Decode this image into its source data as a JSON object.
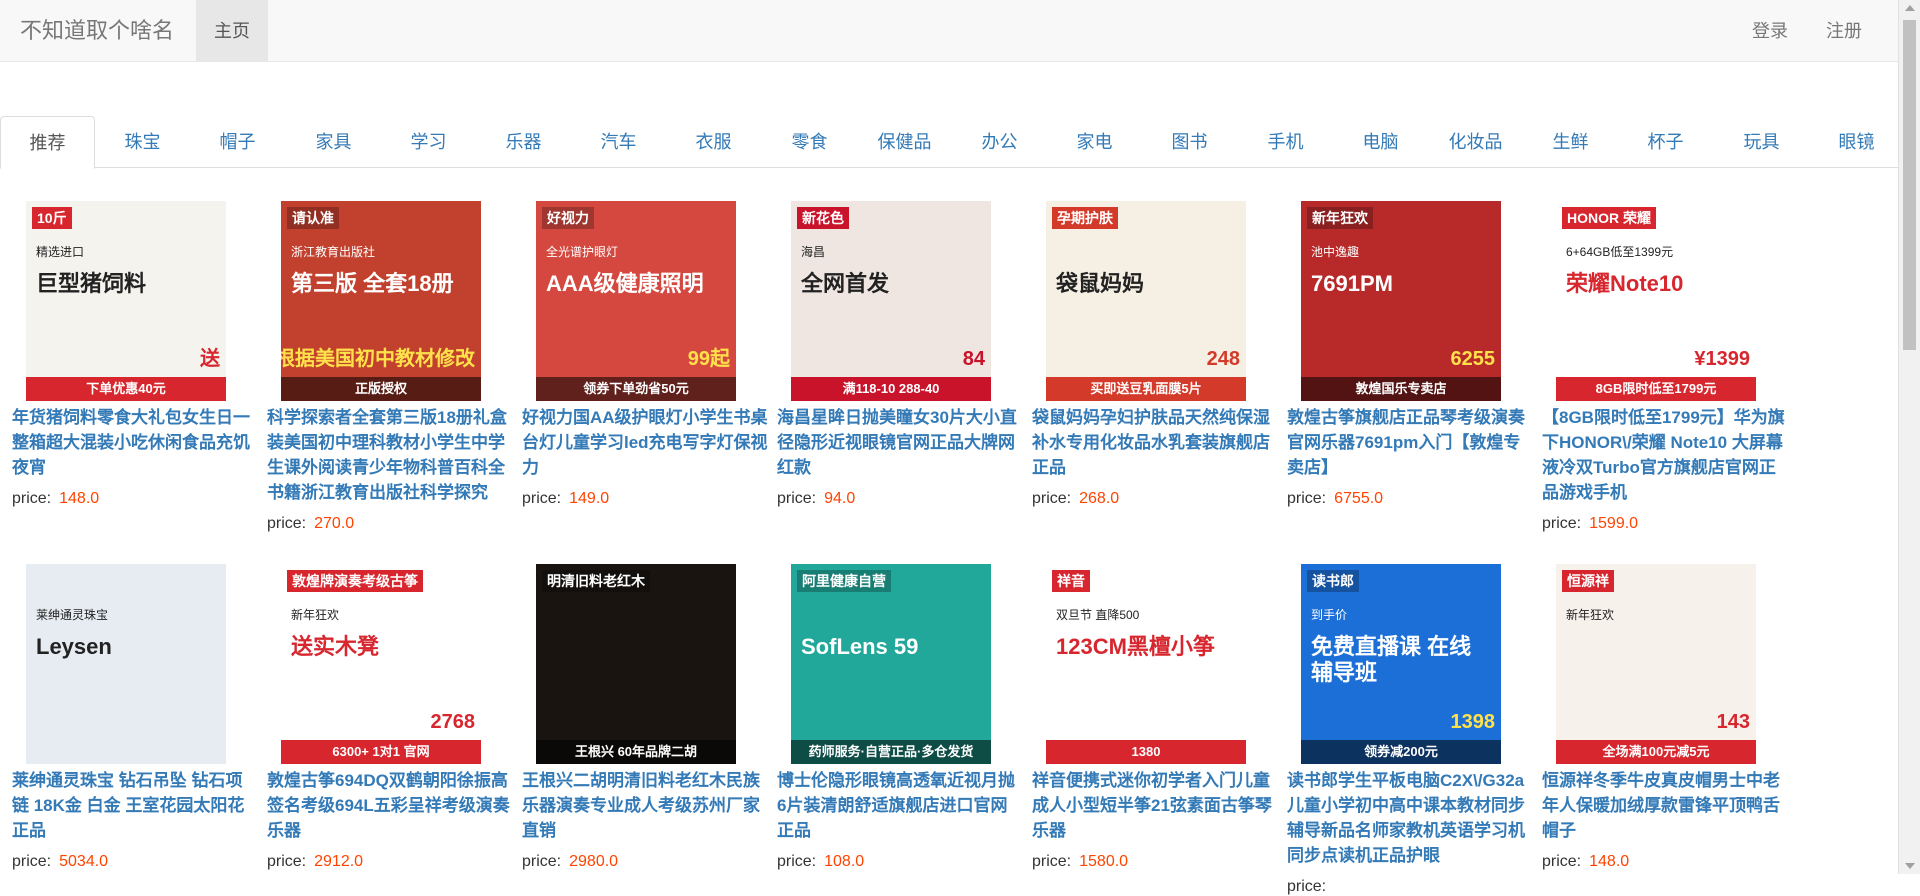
{
  "navbar": {
    "brand": "不知道取个啥名",
    "home": "主页",
    "login": "登录",
    "register": "注册"
  },
  "tabs": [
    "推荐",
    "珠宝",
    "帽子",
    "家具",
    "学习",
    "乐器",
    "汽车",
    "衣服",
    "零食",
    "保健品",
    "办公",
    "家电",
    "图书",
    "手机",
    "电脑",
    "化妆品",
    "生鲜",
    "杯子",
    "玩具",
    "眼镜"
  ],
  "price_label": "price:",
  "products": [
    {
      "title": "年货猪饲料零食大礼包女生日一整箱超大混装小吃休闲食品充饥夜宵",
      "price": "148.0",
      "img": {
        "bg": "#f5f3ee",
        "accent": "#d8262e",
        "badge": "10斤",
        "big": "巨型猪饲料",
        "band": "下单优惠40元",
        "sub": "精选进口",
        "corner": "送"
      }
    },
    {
      "title": "科学探索者全套第三版18册礼盒装美国初中理科教材小学生中学生课外阅读青少年物科普百科全书籍浙江教育出版社科学探究",
      "price": "270.0",
      "img": {
        "bg": "#c2412e",
        "accent": "#1f6e35",
        "badge": "请认准",
        "big": "第三版 全套18册",
        "band": "正版授权",
        "sub": "浙江教育出版社",
        "corner": "根据美国初中教材修改"
      }
    },
    {
      "title": "好视力国AA级护眼灯小学生书桌台灯儿童学习led充电写字灯保视力",
      "price": "149.0",
      "img": {
        "bg": "#d5483f",
        "accent": "#ffffff",
        "badge": "好视力",
        "big": "AAA级健康照明",
        "band": "领券下单劲省50元",
        "sub": "全光谱护眼灯",
        "corner": "99起"
      }
    },
    {
      "title": "海昌星眸日抛美瞳女30片大小直径隐形近视眼镜官网正品大牌网红款",
      "price": "94.0",
      "img": {
        "bg": "#efe6e1",
        "accent": "#c8132b",
        "badge": "新花色",
        "big": "全网首发",
        "band": "满118-10 288-40",
        "sub": "海昌",
        "corner": "84"
      }
    },
    {
      "title": "袋鼠妈妈孕妇护肤品天然纯保湿补水专用化妆品水乳套装旗舰店正品",
      "price": "268.0",
      "img": {
        "bg": "#f6efe4",
        "accent": "#d43a2a",
        "badge": "孕期护肤",
        "big": "袋鼠妈妈",
        "band": "买即送豆乳面膜5片",
        "sub": "",
        "corner": "248"
      }
    },
    {
      "title": "敦煌古筝旗舰店正品琴考级演奏官网乐器7691pm入门【敦煌专卖店】",
      "price": "6755.0",
      "img": {
        "bg": "#b82a2a",
        "accent": "#f2d9a8",
        "badge": "新年狂欢",
        "big": "7691PM",
        "band": "敦煌国乐专卖店",
        "sub": "池中逸趣",
        "corner": "6255"
      }
    },
    {
      "title": "【8GB限时低至1799元】华为旗下HONOR\\/荣耀 Note10 大屏幕液冷双Turbo官方旗舰店官网正品游戏手机",
      "price": "1599.0",
      "img": {
        "bg": "#ffffff",
        "accent": "#d7262e",
        "badge": "HONOR 荣耀",
        "big": "荣耀Note10",
        "band": "8GB限时低至1799元",
        "sub": "6+64GB低至1399元",
        "corner": "¥1399"
      }
    },
    {
      "title": "莱绅通灵珠宝 钻石吊坠 钻石项链 18K金 白金 王室花园太阳花正品",
      "price": "5034.0",
      "img": {
        "bg": "#e7ecf2",
        "accent": "#9aa6b5",
        "badge": "",
        "big": "Leysen",
        "band": "",
        "sub": "莱绅通灵珠宝",
        "corner": ""
      }
    },
    {
      "title": "敦煌古筝694DQ双鹤朝阳徐振高签名考级694L五彩呈祥考级演奏乐器",
      "price": "2912.0",
      "img": {
        "bg": "#ffffff",
        "accent": "#d7262e",
        "badge": "敦煌牌演奏考级古筝",
        "big": "送实木凳",
        "band": "6300+ 1对1 官网",
        "sub": "新年狂欢",
        "corner": "2768"
      }
    },
    {
      "title": "王根兴二胡明清旧料老红木民族乐器演奏专业成人考级苏州厂家直销",
      "price": "2980.0",
      "img": {
        "bg": "#1a1410",
        "accent": "#c8322a",
        "badge": "明清旧料老红木",
        "big": "",
        "band": "王根兴 60年品牌二胡",
        "sub": "",
        "corner": ""
      }
    },
    {
      "title": "博士伦隐形眼镜高透氧近视月抛6片装清朗舒适旗舰店进口官网正品",
      "price": "108.0",
      "img": {
        "bg": "#21a89b",
        "accent": "#ffffff",
        "badge": "阿里健康自营",
        "big": "SofLens 59",
        "band": "药师服务·自营正品·多仓发货",
        "sub": "",
        "corner": ""
      }
    },
    {
      "title": "祥音便携式迷你初学者入门儿童成人小型短半筝21弦素面古筝琴乐器",
      "price": "1580.0",
      "img": {
        "bg": "#ffffff",
        "accent": "#d7262e",
        "badge": "祥音",
        "big": "123CM黑檀小筝",
        "band": "1380",
        "sub": "双旦节 直降500",
        "corner": ""
      }
    },
    {
      "title": "读书郎学生平板电脑C2X\\/G32a儿童小学初中高中课本教材同步辅导新品名师家教机英语学习机同步点读机正品护眼",
      "price": "",
      "img": {
        "bg": "#1c6fd6",
        "accent": "#ffffff",
        "badge": "读书郎",
        "big": "免费直播课 在线辅导班",
        "band": "领券减200元",
        "sub": "到手价",
        "corner": "1398"
      }
    },
    {
      "title": "恒源祥冬季牛皮真皮帽男士中老年人保暖加绒厚款雷锋平顶鸭舌帽子",
      "price": "148.0",
      "img": {
        "bg": "#f7f1ec",
        "accent": "#d7262e",
        "badge": "恒源祥",
        "big": "",
        "band": "全场满100元减5元",
        "sub": "新年狂欢",
        "corner": "143"
      }
    }
  ]
}
